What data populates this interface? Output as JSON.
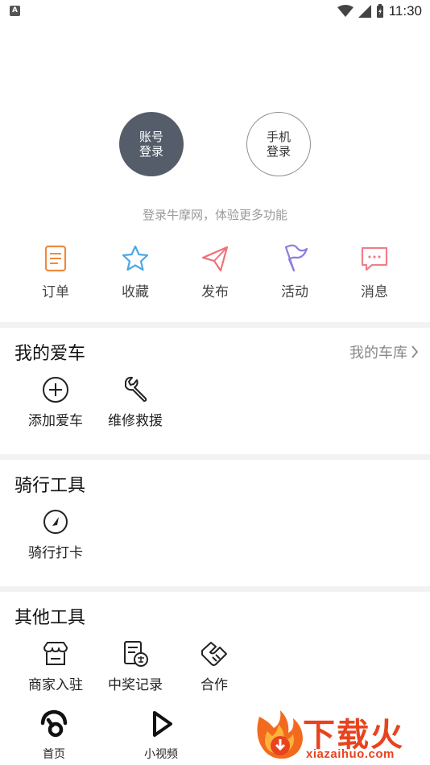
{
  "status_bar": {
    "left_badge": "A",
    "time": "11:30"
  },
  "login": {
    "account_label": "账号登录",
    "phone_label": "手机登录",
    "hint": "登录牛摩网，体验更多功能"
  },
  "quick_items": [
    {
      "label": "订单",
      "icon": "order-icon",
      "color": "#f08a3c"
    },
    {
      "label": "收藏",
      "icon": "star-icon",
      "color": "#4aa8e8"
    },
    {
      "label": "发布",
      "icon": "paper-plane-icon",
      "color": "#f0727a"
    },
    {
      "label": "活动",
      "icon": "flag-icon",
      "color": "#8b7fd8"
    },
    {
      "label": "消息",
      "icon": "message-icon",
      "color": "#ef7f88"
    }
  ],
  "my_car": {
    "title": "我的爱车",
    "link": "我的车库",
    "items": [
      {
        "label": "添加爱车",
        "icon": "plus-circle-icon"
      },
      {
        "label": "维修救援",
        "icon": "wrench-icon"
      }
    ]
  },
  "riding_tools": {
    "title": "骑行工具",
    "items": [
      {
        "label": "骑行打卡",
        "icon": "gauge-icon"
      }
    ]
  },
  "other_tools": {
    "title": "其他工具",
    "items": [
      {
        "label": "商家入驻",
        "icon": "store-icon"
      },
      {
        "label": "中奖记录",
        "icon": "prize-record-icon"
      },
      {
        "label": "合作",
        "icon": "handshake-icon"
      }
    ]
  },
  "bottom_nav": [
    {
      "label": "首页",
      "icon": "home-icon"
    },
    {
      "label": "小视频",
      "icon": "play-icon"
    }
  ],
  "watermark": {
    "text": "下载火",
    "url": "xiazaihuo.com"
  }
}
